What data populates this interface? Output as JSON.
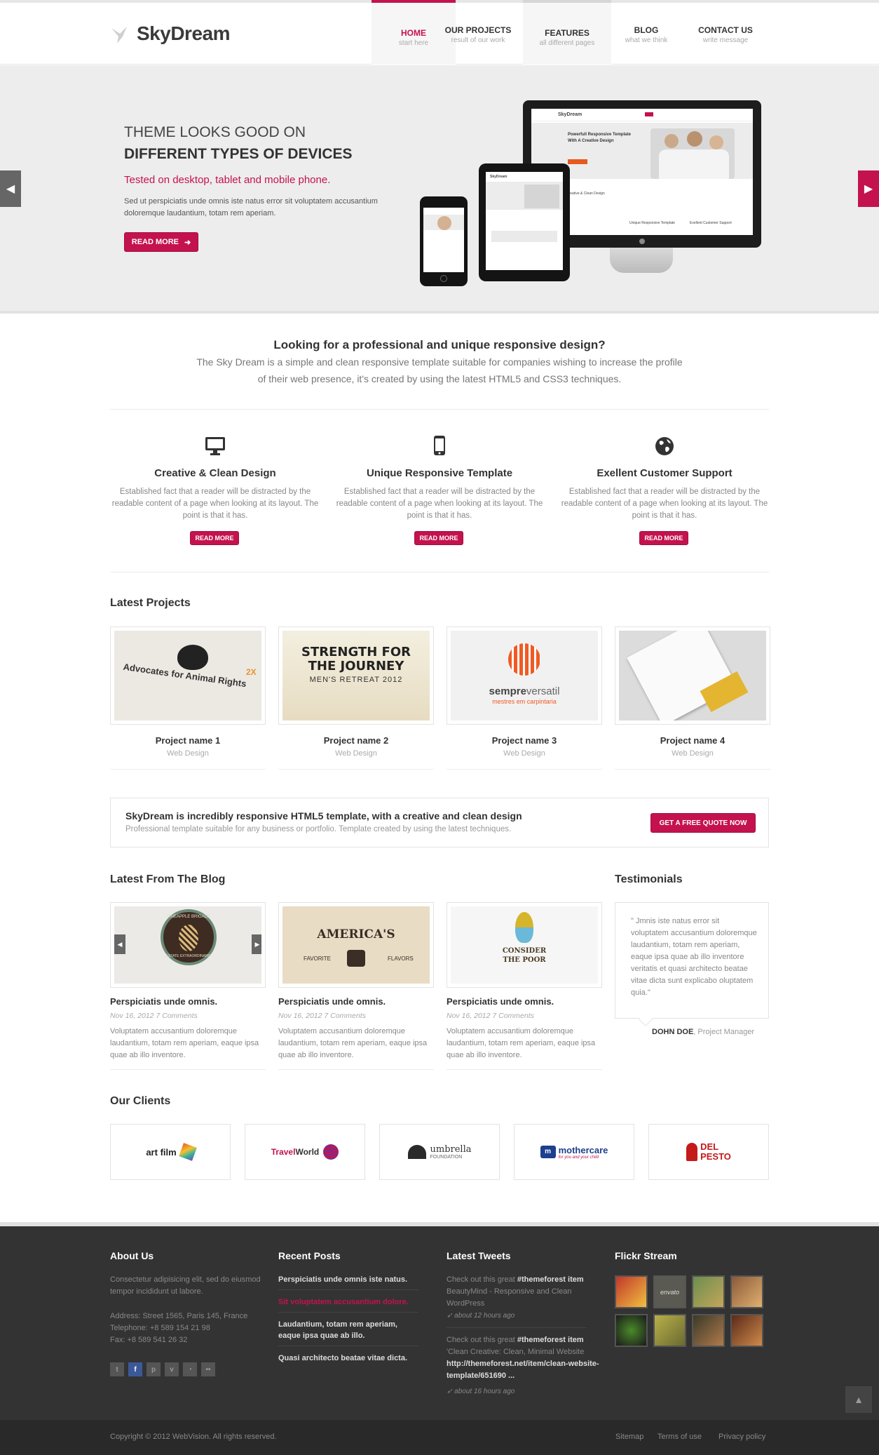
{
  "header": {
    "logo": "SkyDream",
    "nav": [
      {
        "title": "HOME",
        "sub": "start here"
      },
      {
        "title": "OUR PROJECTS",
        "sub": "result of our work"
      },
      {
        "title": "FEATURES",
        "sub": "all different pages"
      },
      {
        "title": "BLOG",
        "sub": "what we think"
      },
      {
        "title": "CONTACT US",
        "sub": "write message"
      }
    ]
  },
  "hero": {
    "line1": "THEME LOOKS GOOD ON",
    "line2": "DIFFERENT TYPES OF DEVICES",
    "tagline": "Tested on desktop, tablet and mobile phone.",
    "text": "Sed ut perspiciatis unde omnis iste natus error sit voluptatem accusantium doloremque laudantium, totam rem aperiam.",
    "button": "READ MORE",
    "desktop_screen": {
      "logo": "SkyDream",
      "headline1": "Powerfull Responsive Template",
      "headline2": "With A Creative Design",
      "feature1": "Creative & Clean Design",
      "feature2": "Unique Responsive Template",
      "feature3": "Exellent Customer Support"
    },
    "tablet_screen": {
      "logo": "SkyDream"
    }
  },
  "intro": {
    "heading": "Looking for a professional and unique responsive design?",
    "text1": "The Sky Dream is a simple and clean responsive template suitable for companies wishing to increase the profile",
    "text2": "of their web presence, it's created by using the latest HTML5 and CSS3 techniques."
  },
  "features": [
    {
      "icon": "monitor-icon",
      "title": "Creative & Clean Design",
      "text": "Established fact that a reader will be distracted by the readable content of a page when looking at its layout. The point is that it has.",
      "button": "READ MORE"
    },
    {
      "icon": "smartphone-icon",
      "title": "Unique Responsive Template",
      "text": "Established fact that a reader will be distracted by the readable content of a page when looking at its layout. The point is that it has.",
      "button": "READ MORE"
    },
    {
      "icon": "globe-icon",
      "title": "Exellent Customer Support",
      "text": "Established fact that a reader will be distracted by the readable content of a page when looking at its layout. The point is that it has.",
      "button": "READ MORE"
    }
  ],
  "projects": {
    "heading": "Latest Projects",
    "items": [
      {
        "name": "Project name 1",
        "cat": "Web Design",
        "img_text": "Advocates for Animal Rights",
        "tag": "2X"
      },
      {
        "name": "Project name 2",
        "cat": "Web Design",
        "img_line1": "STRENGTH FOR",
        "img_line2": "THE JOURNEY",
        "img_line3": "MEN'S RETREAT 2012"
      },
      {
        "name": "Project name 3",
        "cat": "Web Design",
        "img_a": "sempre",
        "img_b": "versatil",
        "img_line2": "mestres em carpintaria"
      },
      {
        "name": "Project name 4",
        "cat": "Web Design"
      }
    ]
  },
  "cta": {
    "title": "SkyDream is incredibly responsive HTML5 template, with a creative and clean design",
    "text": "Professional template suitable for any business or portfolio. Template created by using the latest techniques.",
    "button": "GET A FREE QUOTE NOW"
  },
  "blog": {
    "heading": "Latest From The Blog",
    "items": [
      {
        "title": "Perspiciatis unde omnis.",
        "meta": "Nov 16, 2012 7 Comments",
        "text": "Voluptatem accusantium doloremque laudantium, totam rem aperiam, eaque ipsa quae ab illo inventore.",
        "img_top": "PINEAPPLE BRIGADE",
        "img_bottom": "ESTATE EXTRAORDINAIRE"
      },
      {
        "title": "Perspiciatis unde omnis.",
        "meta": "Nov 16, 2012 7 Comments",
        "text": "Voluptatem accusantium doloremque laudantium, totam rem aperiam, eaque ipsa quae ab illo inventore.",
        "img_main": "AMERICA'S",
        "img_left": "FAVORITE",
        "img_right": "FLAVORS"
      },
      {
        "title": "Perspiciatis unde omnis.",
        "meta": "Nov 16, 2012 7 Comments",
        "text": "Voluptatem accusantium doloremque laudantium, totam rem aperiam, eaque ipsa quae ab illo inventore.",
        "img_line1": "CONSIDER",
        "img_line2": "THE POOR"
      }
    ]
  },
  "testimonials": {
    "heading": "Testimonials",
    "quote": "\" Jmnis iste natus error sit voluptatem accusantium doloremque laudantium, totam rem aperiam, eaque ipsa quae ab illo inventore veritatis et quasi architecto beatae vitae dicta sunt explicabo oluptatem quia.\"",
    "author": "DOHN DOE",
    "role": ", Project Manager"
  },
  "clients": {
    "heading": "Our Clients",
    "items": [
      {
        "a": "art",
        "b": "film"
      },
      {
        "a": "Travel",
        "b": "World"
      },
      {
        "a": "umbrella",
        "b": "FOUNDATION"
      },
      {
        "a": "mothercare",
        "b": "for you and your child"
      },
      {
        "a": "DEL",
        "b": "PESTO"
      }
    ]
  },
  "footer": {
    "about": {
      "heading": "About Us",
      "text": "Consectetur adipisicing elit, sed do eiusmod tempor incididunt ut labore.",
      "address": "Address: Street 1565, Paris 145, France",
      "phone": "Telephone: +8 589 154 21 98",
      "fax": "Fax: +8 589 541 26 32"
    },
    "posts": {
      "heading": "Recent Posts",
      "items": [
        "Perspiciatis unde omnis iste natus.",
        "Sit voluptatem accusantium dolore.",
        "Laudantium, totam rem aperiam, eaque ipsa quae ab illo.",
        "Quasi architecto beatae vitae dicta."
      ]
    },
    "tweets": {
      "heading": "Latest Tweets",
      "t1_pre": "Check out this great ",
      "t1_tag": "#themeforest item",
      "t1_rest": "BeautyMind - Responsive and Clean WordPress",
      "t1_time": "about 12 hours ago",
      "t2_pre": "Check out this great ",
      "t2_tag": "#themeforest item",
      "t2_rest": "'Clean Creative: Clean, Minimal Website",
      "t2_link": "http://themeforest.net/item/clean-website-template/651690 ...",
      "t2_time": "about 16 hours ago"
    },
    "flickr": {
      "heading": "Flickr Stream",
      "tile_text": "envato"
    },
    "social": [
      "t",
      "f",
      "p",
      "v",
      "rss",
      "fl"
    ]
  },
  "bottom": {
    "copyright": "Copyright © 2012 WebVision. All rights reserved.",
    "links": [
      "Sitemap",
      "Terms of use",
      "Privacy policy"
    ]
  },
  "colors": {
    "accent": "#c4124f",
    "footer_bg": "#333333",
    "hero_bg": "#ededed"
  }
}
